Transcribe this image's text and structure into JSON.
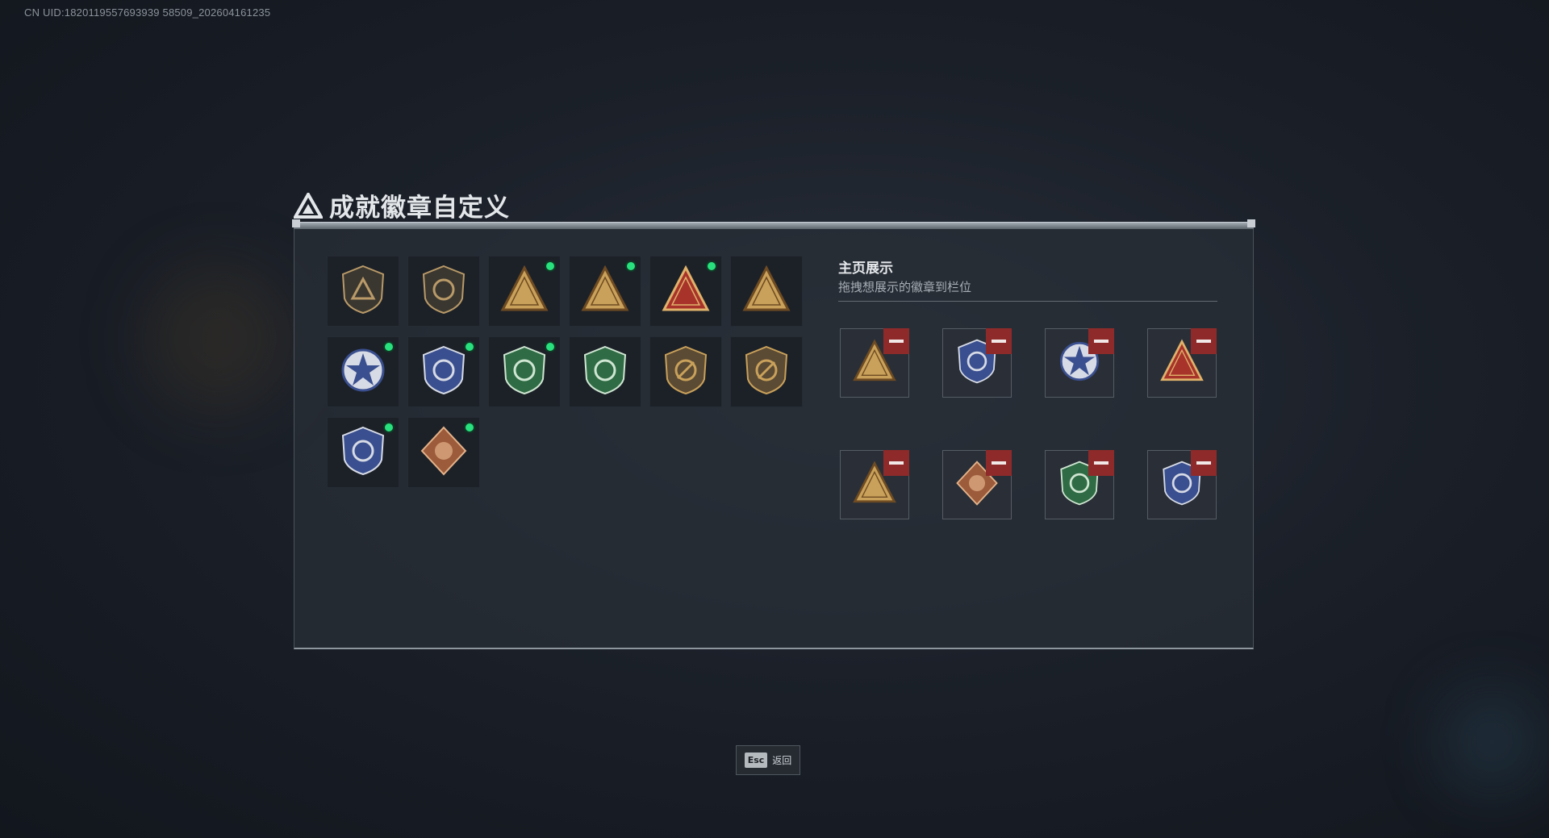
{
  "uid": "CN UID:1820119557693939 58509_202604161235",
  "title": "成就徽章自定义",
  "collection": {
    "badges": [
      {
        "icon": "shield-triangle-icon",
        "new": false,
        "tone": "dark"
      },
      {
        "icon": "helicopter-shield-icon",
        "new": false,
        "tone": "dark"
      },
      {
        "icon": "tower-triangle-icon",
        "new": true,
        "tone": "gold"
      },
      {
        "icon": "sb-triangle-icon",
        "new": true,
        "tone": "gold"
      },
      {
        "icon": "number-one-triangle-icon",
        "new": true,
        "tone": "red"
      },
      {
        "icon": "soldiers-triangle-icon",
        "new": false,
        "tone": "gold"
      },
      {
        "icon": "eagle-star-icon",
        "new": true,
        "tone": "blue"
      },
      {
        "icon": "blue-shield-icon",
        "new": true,
        "tone": "blue"
      },
      {
        "icon": "green-shield-icon",
        "new": true,
        "tone": "green"
      },
      {
        "icon": "green-rifle-shield-icon",
        "new": false,
        "tone": "green"
      },
      {
        "icon": "no-gun-shield-icon",
        "new": false,
        "tone": "brown"
      },
      {
        "icon": "no-gun-shield-icon",
        "new": false,
        "tone": "brown"
      },
      {
        "icon": "rotate-shield-icon",
        "new": true,
        "tone": "blue"
      },
      {
        "icon": "dragon-diamond-icon",
        "new": true,
        "tone": "copper"
      }
    ]
  },
  "showcase": {
    "title": "主页展示",
    "subtitle": "拖拽想展示的徽章到栏位",
    "slots": [
      {
        "icon": "sb-triangle-icon",
        "tone": "gold"
      },
      {
        "icon": "blue-shield-icon",
        "tone": "blue"
      },
      {
        "icon": "eagle-star-icon",
        "tone": "blue"
      },
      {
        "icon": "number-one-triangle-icon",
        "tone": "red"
      },
      {
        "icon": "tower-triangle-icon",
        "tone": "gold"
      },
      {
        "icon": "dragon-diamond-icon",
        "tone": "copper"
      },
      {
        "icon": "green-shield-icon",
        "tone": "green"
      },
      {
        "icon": "rotate-shield-icon",
        "tone": "blue"
      }
    ]
  },
  "footer": {
    "esc_key": "Esc",
    "esc_label": "返回"
  },
  "colors": {
    "new_dot": "#29e07e",
    "remove": "#8f2a2a",
    "gold": "#c9a15a",
    "blue": "#3a4f8f",
    "green": "#2f6b44"
  }
}
